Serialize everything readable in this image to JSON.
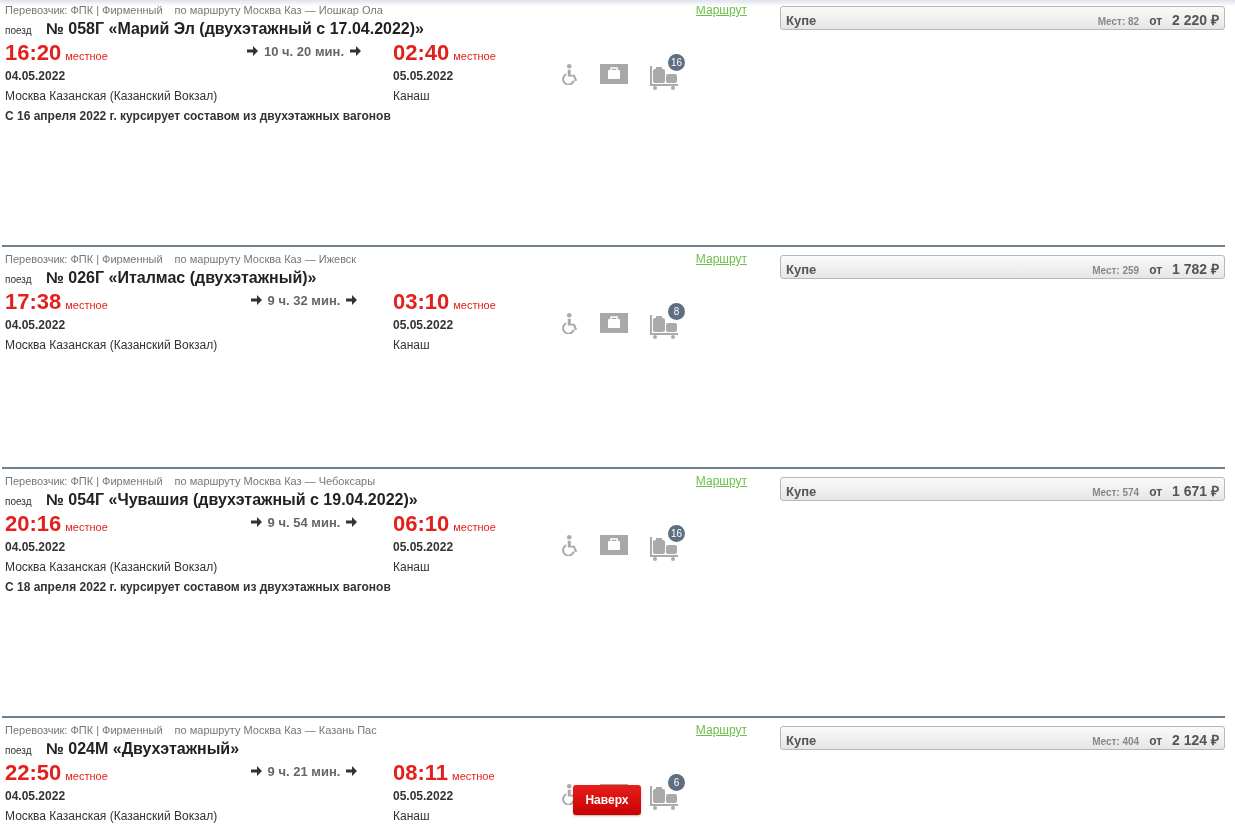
{
  "trains": [
    {
      "carrier": "Перевозчик: ФПК | Фирменный",
      "route": "по маршруту Москва Каз — Йошкар Ола",
      "route_link": "Маршрут",
      "train_label": "поезд",
      "title": "№ 058Г «Марий Эл (двухэтажный с 17.04.2022)»",
      "depart_time": "16:20",
      "depart_zone": "местное",
      "duration": "10 ч. 20 мин.",
      "arrive_time": "02:40",
      "arrive_zone": "местное",
      "depart_date": "04.05.2022",
      "arrive_date": "05.05.2022",
      "depart_station": "Москва Казанская (Казанский Вокзал)",
      "arrive_station": "Канаш",
      "note": "С 16 апреля 2022 г. курсирует составом из двухэтажных вагонов",
      "luggage_count": "16",
      "car_class": "Купе",
      "seats": "Мест: 82",
      "price_from": "от",
      "price": "2 220 ₽"
    },
    {
      "carrier": "Перевозчик: ФПК | Фирменный",
      "route": "по маршруту Москва Каз — Ижевск",
      "route_link": "Маршрут",
      "train_label": "поезд",
      "title": "№ 026Г «Италмас (двухэтажный)»",
      "depart_time": "17:38",
      "depart_zone": "местное",
      "duration": "9 ч. 32 мин.",
      "arrive_time": "03:10",
      "arrive_zone": "местное",
      "depart_date": "04.05.2022",
      "arrive_date": "05.05.2022",
      "depart_station": "Москва Казанская (Казанский Вокзал)",
      "arrive_station": "Канаш",
      "luggage_count": "8",
      "car_class": "Купе",
      "seats": "Мест: 259",
      "price_from": "от",
      "price": "1 782 ₽"
    },
    {
      "carrier": "Перевозчик: ФПК | Фирменный",
      "route": "по маршруту Москва Каз — Чебоксары",
      "route_link": "Маршрут",
      "train_label": "поезд",
      "title": "№ 054Г «Чувашия (двухэтажный с 19.04.2022)»",
      "depart_time": "20:16",
      "depart_zone": "местное",
      "duration": "9 ч. 54 мин.",
      "arrive_time": "06:10",
      "arrive_zone": "местное",
      "depart_date": "04.05.2022",
      "arrive_date": "05.05.2022",
      "depart_station": "Москва Казанская (Казанский Вокзал)",
      "arrive_station": "Канаш",
      "note": "С 18 апреля 2022 г. курсирует составом из двухэтажных вагонов",
      "luggage_count": "16",
      "car_class": "Купе",
      "seats": "Мест: 574",
      "price_from": "от",
      "price": "1 671 ₽"
    },
    {
      "carrier": "Перевозчик: ФПК | Фирменный",
      "route": "по маршруту Москва Каз — Казань Пас",
      "route_link": "Маршрут",
      "train_label": "поезд",
      "title": "№ 024М «Двухэтажный»",
      "depart_time": "22:50",
      "depart_zone": "местное",
      "duration": "9 ч. 21 мин.",
      "arrive_time": "08:11",
      "arrive_zone": "местное",
      "depart_date": "04.05.2022",
      "arrive_date": "05.05.2022",
      "depart_station": "Москва Казанская (Казанский Вокзал)",
      "arrive_station": "Канаш",
      "luggage_count": "6",
      "car_class": "Купе",
      "seats": "Мест: 404",
      "price_from": "от",
      "price": "2 124 ₽"
    }
  ],
  "to_top_button": "Наверх"
}
